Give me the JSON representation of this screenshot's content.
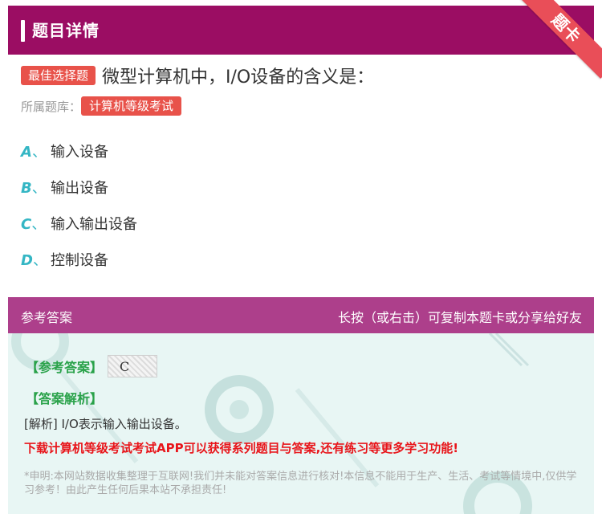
{
  "colors": {
    "accent": "#9b0d63",
    "tag_red": "#e8524a",
    "option_letter": "#34b6c4",
    "answer_header": "#ad3f8b",
    "answer_bg": "#e8f6f4",
    "green_label": "#2aa24a",
    "promo_red": "#e8151a"
  },
  "header": {
    "title": "题目详情",
    "corner_tag": "题卡"
  },
  "question": {
    "type_tag": "最佳选择题",
    "text": "微型计算机中，I/O设备的含义是：",
    "library_label": "所属题库：",
    "library_tag": "计算机等级考试"
  },
  "options": [
    {
      "letter": "A",
      "sep": "、",
      "text": "输入设备"
    },
    {
      "letter": "B",
      "sep": "、",
      "text": "输出设备"
    },
    {
      "letter": "C",
      "sep": "、",
      "text": "输入输出设备"
    },
    {
      "letter": "D",
      "sep": "、",
      "text": "控制设备"
    }
  ],
  "answer_section": {
    "header_left": "参考答案",
    "header_right": "长按（或右击）可复制本题卡或分享给好友",
    "ref_answer_label": "【参考答案】",
    "ref_answer_value": "C",
    "analysis_label": "【答案解析】",
    "analysis_text": "[解析] I/O表示输入输出设备。",
    "promo_text": "下载计算机等级考试考试APP可以获得系列题目与答案,还有练习等更多学习功能!",
    "disclaimer": "*申明:本网站数据收集整理于互联网!我们并未能对答案信息进行核对!本信息不能用于生产、生活、考试等情境中,仅供学习参考！由此产生任何后果本站不承担责任!"
  }
}
